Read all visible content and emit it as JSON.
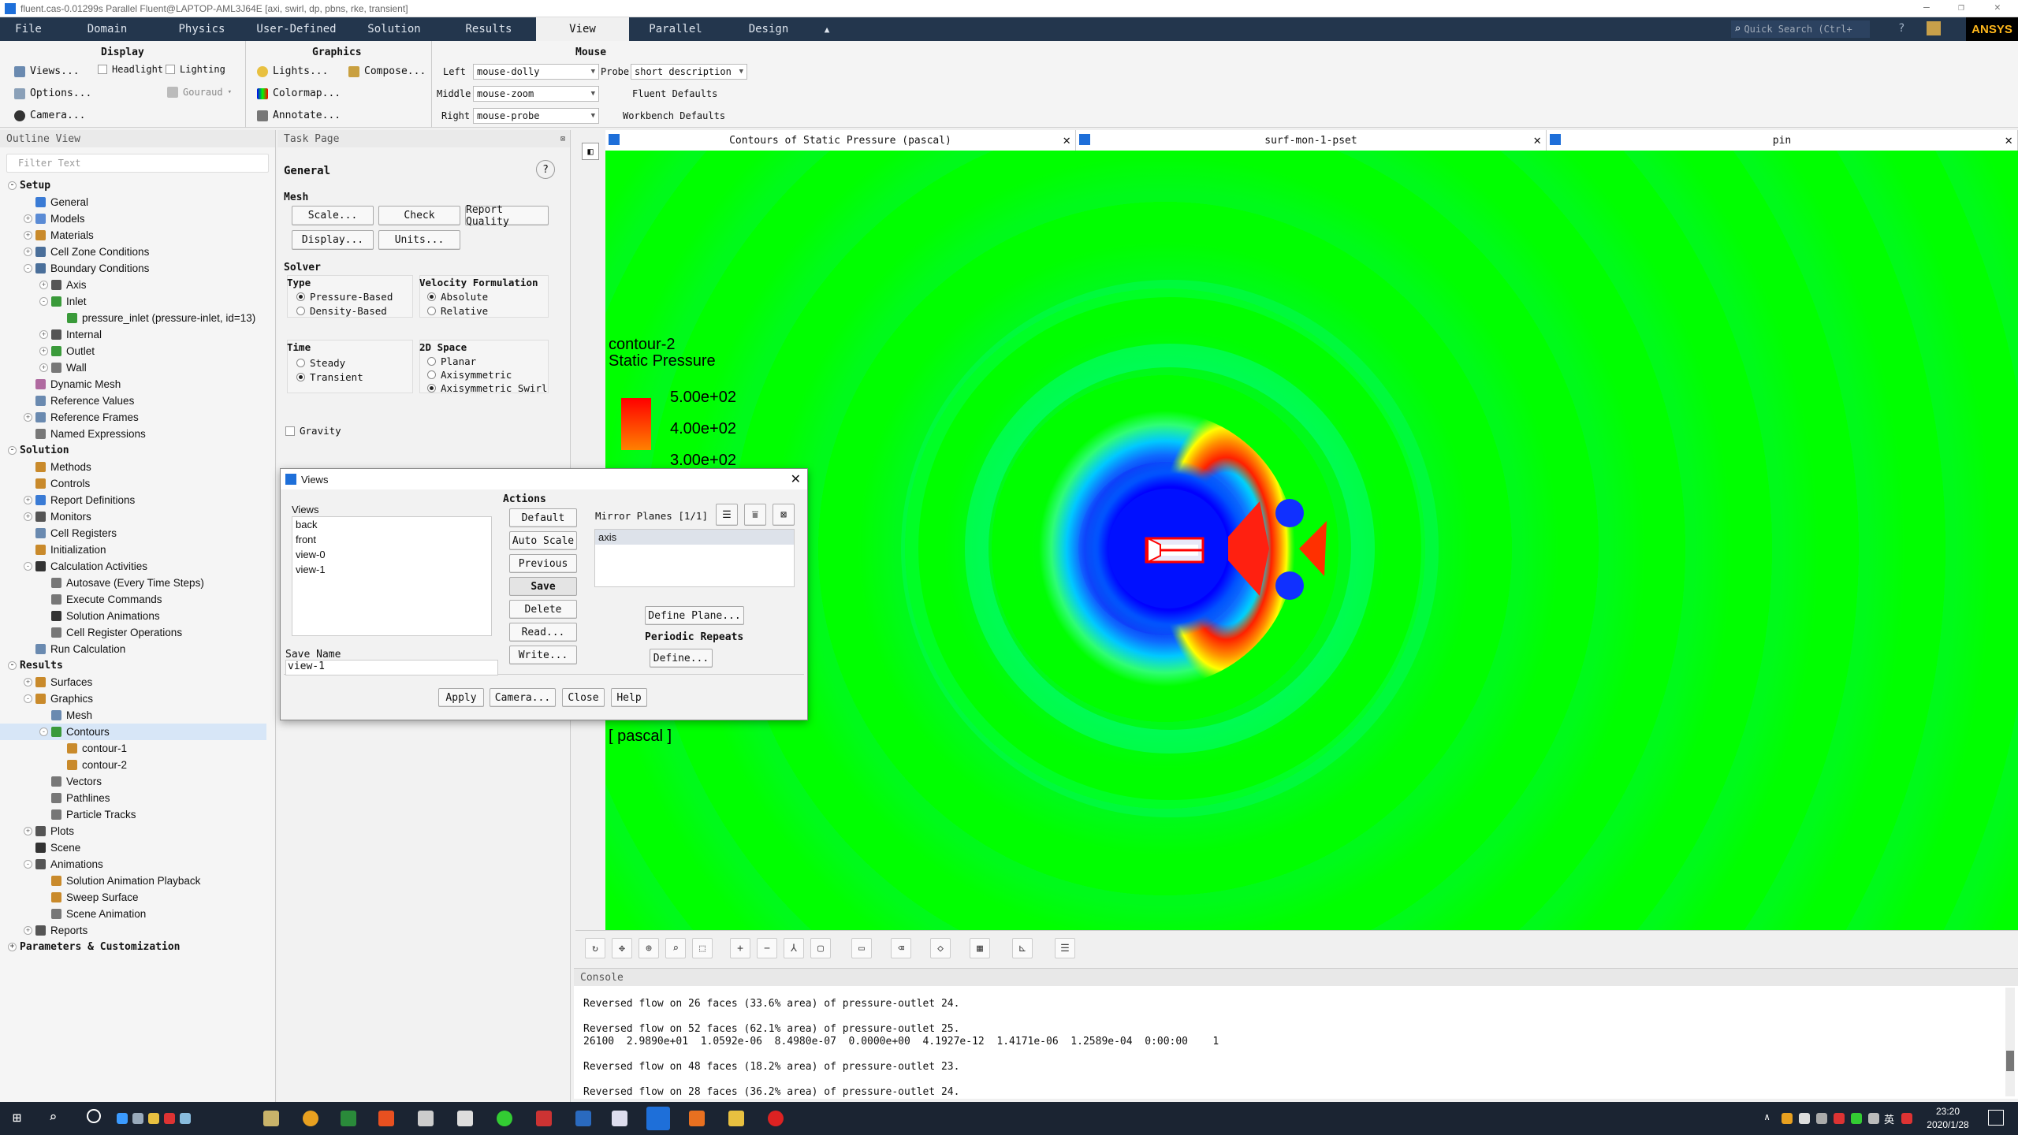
{
  "window": {
    "title": "fluent.cas-0.01299s Parallel Fluent@LAPTOP-AML3J64E  [axi, swirl, dp, pbns, rke, transient]"
  },
  "menu": [
    "File",
    "Domain",
    "Physics",
    "User-Defined",
    "Solution",
    "Results",
    "View",
    "Parallel",
    "Design"
  ],
  "menu_active": "View",
  "quick_search": {
    "placeholder": "Quick Search (Ctrl+"
  },
  "brand": "ANSYS",
  "ribbon": {
    "display": {
      "title": "Display",
      "views": "Views...",
      "options": "Options...",
      "camera": "Camera...",
      "headlight": "Headlight",
      "lighting": "Lighting",
      "gouraud": "Gouraud"
    },
    "graphics": {
      "title": "Graphics",
      "lights": "Lights...",
      "compose": "Compose...",
      "colormap": "Colormap...",
      "annotate": "Annotate..."
    },
    "mouse": {
      "title": "Mouse",
      "left_label": "Left",
      "left_value": "mouse-dolly",
      "middle_label": "Middle",
      "middle_value": "mouse-zoom",
      "right_label": "Right",
      "right_value": "mouse-probe",
      "probe_label": "Probe",
      "probe_value": "short description",
      "fluent_defaults": "Fluent Defaults",
      "workbench_defaults": "Workbench Defaults"
    }
  },
  "outline": {
    "title": "Outline View",
    "filter_placeholder": "Filter Text",
    "items": [
      {
        "label": "Setup",
        "level": 0,
        "hdr": true,
        "exp": "-"
      },
      {
        "label": "General",
        "level": 1,
        "icon": "#3a7bd5"
      },
      {
        "label": "Models",
        "level": 1,
        "icon": "#5a8bd5",
        "exp": "+"
      },
      {
        "label": "Materials",
        "level": 1,
        "icon": "#c98a2b",
        "exp": "+"
      },
      {
        "label": "Cell Zone Conditions",
        "level": 1,
        "icon": "#4a6f9a",
        "exp": "+"
      },
      {
        "label": "Boundary Conditions",
        "level": 1,
        "icon": "#4a6f9a",
        "exp": "-"
      },
      {
        "label": "Axis",
        "level": 2,
        "icon": "#555",
        "exp": "+"
      },
      {
        "label": "Inlet",
        "level": 2,
        "icon": "#3a9a3a",
        "exp": "-"
      },
      {
        "label": "pressure_inlet (pressure-inlet, id=13)",
        "level": 3,
        "icon": "#3a9a3a"
      },
      {
        "label": "Internal",
        "level": 2,
        "icon": "#555",
        "exp": "+"
      },
      {
        "label": "Outlet",
        "level": 2,
        "icon": "#3a9a3a",
        "exp": "+"
      },
      {
        "label": "Wall",
        "level": 2,
        "icon": "#777",
        "exp": "+"
      },
      {
        "label": "Dynamic Mesh",
        "level": 1,
        "icon": "#b06aa0"
      },
      {
        "label": "Reference Values",
        "level": 1,
        "icon": "#6a8ab0"
      },
      {
        "label": "Reference Frames",
        "level": 1,
        "icon": "#6a8ab0",
        "exp": "+"
      },
      {
        "label": "Named Expressions",
        "level": 1,
        "icon": "#777"
      },
      {
        "label": "Solution",
        "level": 0,
        "hdr": true,
        "exp": "-"
      },
      {
        "label": "Methods",
        "level": 1,
        "icon": "#c98a2b"
      },
      {
        "label": "Controls",
        "level": 1,
        "icon": "#c98a2b"
      },
      {
        "label": "Report Definitions",
        "level": 1,
        "icon": "#3a7bd5",
        "exp": "+"
      },
      {
        "label": "Monitors",
        "level": 1,
        "icon": "#555",
        "exp": "+"
      },
      {
        "label": "Cell Registers",
        "level": 1,
        "icon": "#6a8ab0"
      },
      {
        "label": "Initialization",
        "level": 1,
        "icon": "#c98a2b"
      },
      {
        "label": "Calculation Activities",
        "level": 1,
        "icon": "#333",
        "exp": "-"
      },
      {
        "label": "Autosave (Every Time Steps)",
        "level": 2,
        "icon": "#777"
      },
      {
        "label": "Execute Commands",
        "level": 2,
        "icon": "#777"
      },
      {
        "label": "Solution Animations",
        "level": 2,
        "icon": "#333"
      },
      {
        "label": "Cell Register Operations",
        "level": 2,
        "icon": "#777"
      },
      {
        "label": "Run Calculation",
        "level": 1,
        "icon": "#6a8ab0"
      },
      {
        "label": "Results",
        "level": 0,
        "hdr": true,
        "exp": "-"
      },
      {
        "label": "Surfaces",
        "level": 1,
        "icon": "#c98a2b",
        "exp": "+"
      },
      {
        "label": "Graphics",
        "level": 1,
        "icon": "#c98a2b",
        "exp": "-"
      },
      {
        "label": "Mesh",
        "level": 2,
        "icon": "#6a8ab0"
      },
      {
        "label": "Contours",
        "level": 2,
        "icon": "#3a9a3a",
        "exp": "-",
        "sel": true
      },
      {
        "label": "contour-1",
        "level": 3,
        "icon": "#c98a2b"
      },
      {
        "label": "contour-2",
        "level": 3,
        "icon": "#c98a2b"
      },
      {
        "label": "Vectors",
        "level": 2,
        "icon": "#777"
      },
      {
        "label": "Pathlines",
        "level": 2,
        "icon": "#777"
      },
      {
        "label": "Particle Tracks",
        "level": 2,
        "icon": "#777"
      },
      {
        "label": "Plots",
        "level": 1,
        "icon": "#555",
        "exp": "+"
      },
      {
        "label": "Scene",
        "level": 1,
        "icon": "#333"
      },
      {
        "label": "Animations",
        "level": 1,
        "icon": "#555",
        "exp": "-"
      },
      {
        "label": "Solution Animation Playback",
        "level": 2,
        "icon": "#c98a2b"
      },
      {
        "label": "Sweep Surface",
        "level": 2,
        "icon": "#c98a2b"
      },
      {
        "label": "Scene Animation",
        "level": 2,
        "icon": "#777"
      },
      {
        "label": "Reports",
        "level": 1,
        "icon": "#555",
        "exp": "+"
      },
      {
        "label": "Parameters & Customization",
        "level": 0,
        "hdr": true,
        "exp": "+"
      }
    ]
  },
  "task": {
    "title": "Task Page",
    "general": "General",
    "mesh": "Mesh",
    "scale": "Scale...",
    "check": "Check",
    "report_quality": "Report Quality",
    "display": "Display...",
    "units": "Units...",
    "solver": "Solver",
    "type": "Type",
    "pressure_based": "Pressure-Based",
    "density_based": "Density-Based",
    "velocity_formulation": "Velocity Formulation",
    "absolute": "Absolute",
    "relative": "Relative",
    "time": "Time",
    "steady": "Steady",
    "transient": "Transient",
    "space": "2D Space",
    "planar": "Planar",
    "axisymmetric": "Axisymmetric",
    "axisymmetric_swirl": "Axisymmetric Swirl",
    "gravity": "Gravity"
  },
  "graphics_tabs": [
    "Contours of Static Pressure (pascal)",
    "surf-mon-1-pset",
    "pin"
  ],
  "legend": {
    "name": "contour-2",
    "quantity": "Static Pressure",
    "values": [
      "5.00e+02",
      "4.00e+02",
      "3.00e+02"
    ],
    "unit": "[ pascal ]"
  },
  "views_dialog": {
    "title": "Views",
    "views_label": "Views",
    "views": [
      "back",
      "front",
      "view-0",
      "view-1"
    ],
    "actions_label": "Actions",
    "default": "Default",
    "auto_scale": "Auto Scale",
    "previous": "Previous",
    "save": "Save",
    "delete": "Delete",
    "read": "Read...",
    "write": "Write...",
    "mirror_label": "Mirror Planes [1/1]",
    "mirror_items": [
      "axis"
    ],
    "define_plane": "Define Plane...",
    "periodic_label": "Periodic Repeats",
    "define": "Define...",
    "save_name_label": "Save Name",
    "save_name": "view-1",
    "apply": "Apply",
    "camera": "Camera...",
    "close": "Close",
    "help": "Help"
  },
  "console": {
    "title": "Console",
    "lines": [
      "Reversed flow on 26 faces (33.6% area) of pressure-outlet 24.",
      "",
      "Reversed flow on 52 faces (62.1% area) of pressure-outlet 25.",
      "26100  2.9890e+01  1.0592e-06  8.4980e-07  0.0000e+00  4.1927e-12  1.4171e-06  1.2589e-04  0:00:00    1",
      "",
      "Reversed flow on 48 faces (18.2% area) of pressure-outlet 23.",
      "",
      "Reversed flow on 28 faces (36.2% area) of pressure-outlet 24."
    ]
  },
  "clock": {
    "time": "23:20",
    "date": "2020/1/28",
    "ime": "英"
  }
}
